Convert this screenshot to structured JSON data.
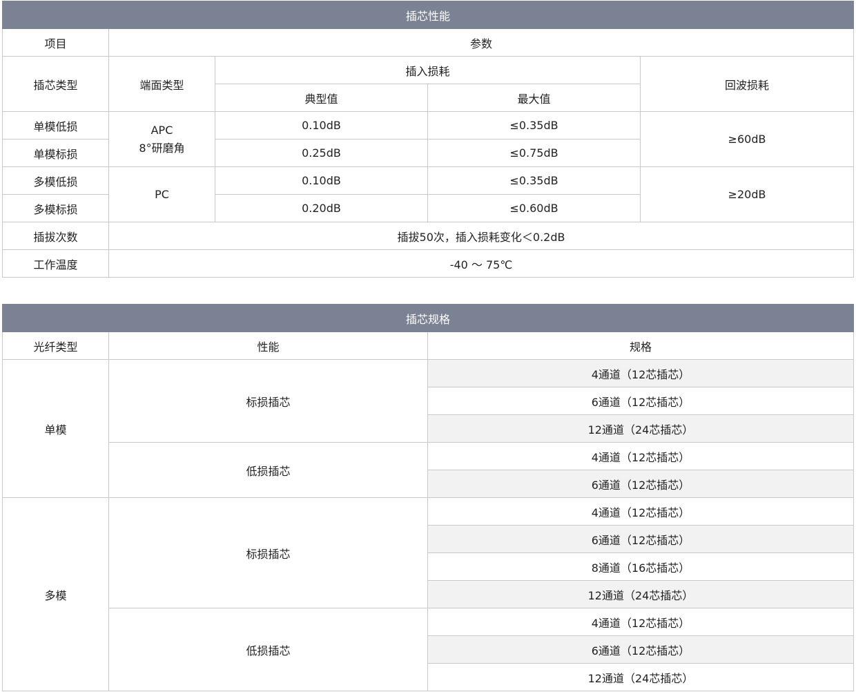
{
  "performance": {
    "title": "插芯性能",
    "headers": {
      "item": "项目",
      "param": "参数",
      "ferrule_type": "插芯类型",
      "endface_type": "端面类型",
      "insertion_loss": "插入损耗",
      "typical": "典型值",
      "max": "最大值",
      "return_loss": "回波损耗"
    },
    "rows": [
      {
        "type": "单模低损",
        "typical": "0.10dB",
        "max": "≤0.35dB"
      },
      {
        "type": "单模标损",
        "typical": "0.25dB",
        "max": "≤0.75dB"
      },
      {
        "type": "多模低损",
        "typical": "0.10dB",
        "max": "≤0.35dB"
      },
      {
        "type": "多模标损",
        "typical": "0.20dB",
        "max": "≤0.60dB"
      }
    ],
    "endface_sm_line1": "APC",
    "endface_sm_line2": "8°研磨角",
    "endface_mm": "PC",
    "return_loss_sm": "≥60dB",
    "return_loss_mm": "≥20dB",
    "mating_label": "插拔次数",
    "mating_value": "插拔50次，插入损耗变化＜0.2dB",
    "temp_label": "工作温度",
    "temp_value": "-40 ～ 75℃"
  },
  "specs": {
    "title": "插芯规格",
    "headers": {
      "fiber_type": "光纤类型",
      "performance": "性能",
      "spec": "规格"
    },
    "single_mode": "单模",
    "multi_mode": "多模",
    "standard_loss": "标损插芯",
    "low_loss": "低损插芯",
    "sm_standard": [
      "4通道（12芯插芯）",
      "6通道（12芯插芯）",
      "12通道（24芯插芯）"
    ],
    "sm_low": [
      "4通道（12芯插芯）",
      "6通道（12芯插芯）"
    ],
    "mm_standard": [
      "4通道（12芯插芯）",
      "6通道（12芯插芯）",
      "8通道（16芯插芯）",
      "12通道（24芯插芯）"
    ],
    "mm_low": [
      "4通道（12芯插芯）",
      "6通道（12芯插芯）",
      "12通道（24芯插芯）"
    ]
  },
  "colors": {
    "banner": "#7b8293",
    "border": "#c8c8c8",
    "alt_row": "#f2f2f2"
  }
}
